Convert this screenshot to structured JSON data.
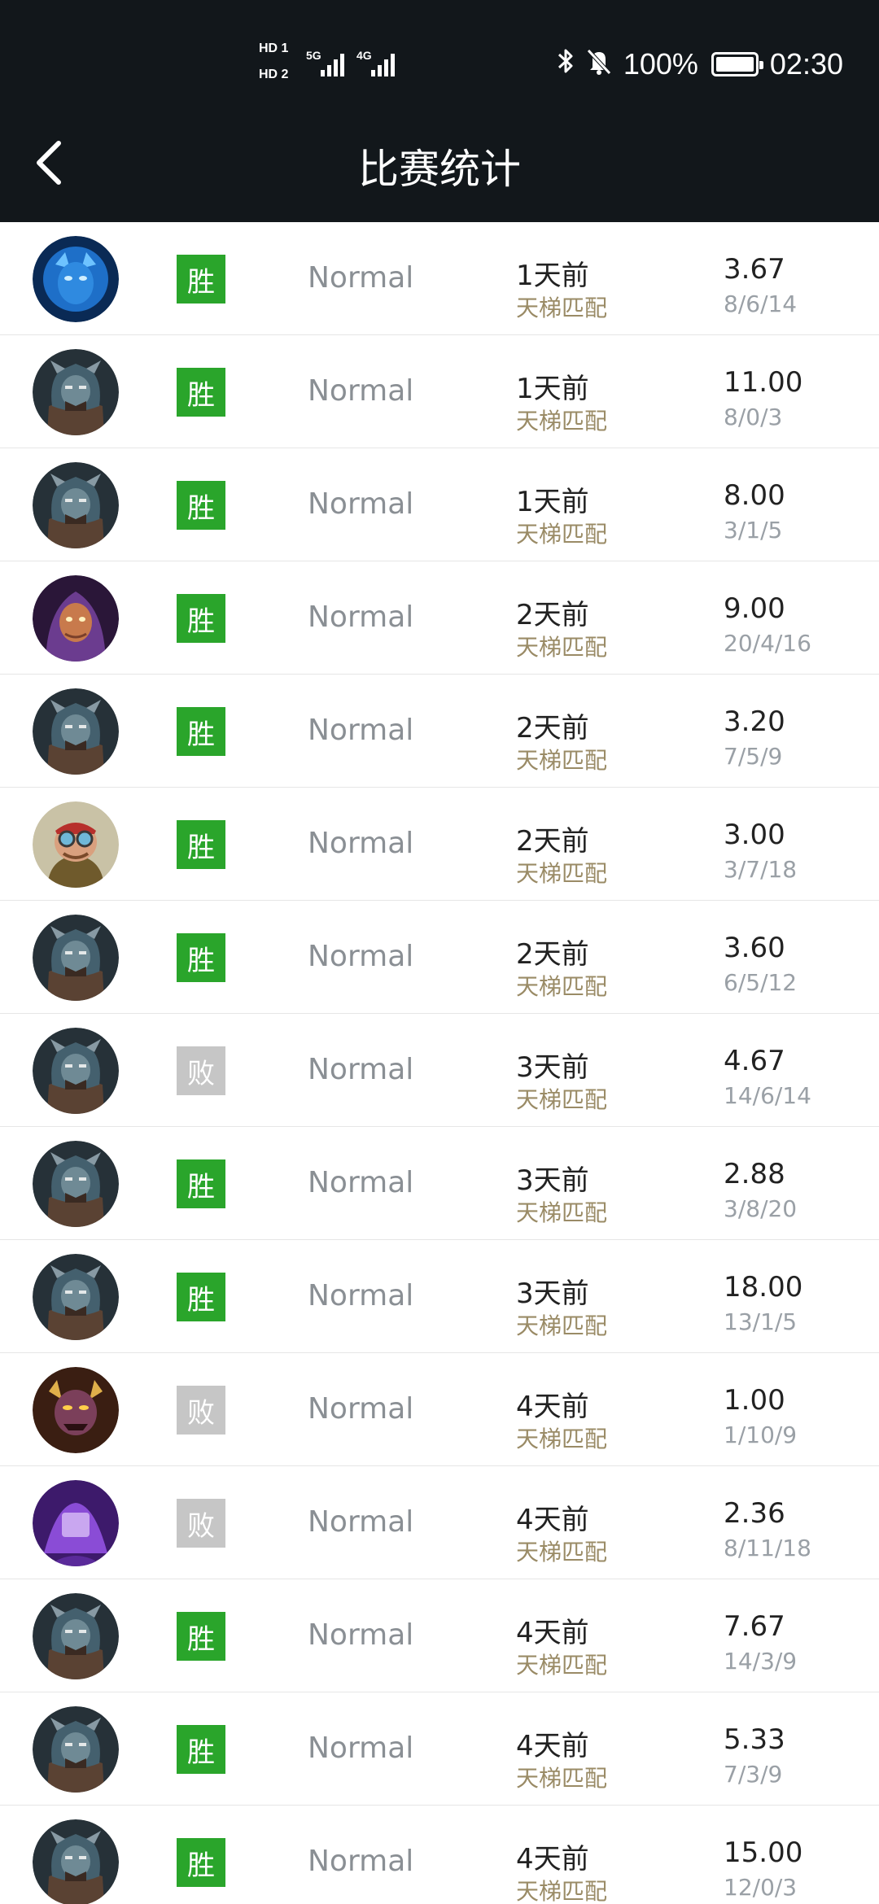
{
  "status_bar": {
    "sim1": "HD 1",
    "sim2": "HD 2",
    "net1": "5G",
    "net2": "4G",
    "battery": "100%",
    "time": "02:30",
    "icons": [
      "bluetooth-icon",
      "mute-icon",
      "battery-icon"
    ]
  },
  "header": {
    "title": "比赛统计",
    "back_icon": "chevron-left-icon"
  },
  "colors": {
    "header_bg": "#12171b",
    "win": "#2aa52b",
    "loss": "#c6c6c6",
    "match_type": "#9a8b66"
  },
  "matches": [
    {
      "hero": "blue-hero",
      "result": "胜",
      "win": true,
      "mode": "Normal",
      "time": "1天前",
      "type": "天梯匹配",
      "kda": "3.67",
      "detail": "8/6/14"
    },
    {
      "hero": "armored-hero",
      "result": "胜",
      "win": true,
      "mode": "Normal",
      "time": "1天前",
      "type": "天梯匹配",
      "kda": "11.00",
      "detail": "8/0/3"
    },
    {
      "hero": "armored-hero",
      "result": "胜",
      "win": true,
      "mode": "Normal",
      "time": "1天前",
      "type": "天梯匹配",
      "kda": "8.00",
      "detail": "3/1/5"
    },
    {
      "hero": "purple-hooded-hero",
      "result": "胜",
      "win": true,
      "mode": "Normal",
      "time": "2天前",
      "type": "天梯匹配",
      "kda": "9.00",
      "detail": "20/4/16"
    },
    {
      "hero": "armored-hero",
      "result": "胜",
      "win": true,
      "mode": "Normal",
      "time": "2天前",
      "type": "天梯匹配",
      "kda": "3.20",
      "detail": "7/5/9"
    },
    {
      "hero": "goggles-hero",
      "result": "胜",
      "win": true,
      "mode": "Normal",
      "time": "2天前",
      "type": "天梯匹配",
      "kda": "3.00",
      "detail": "3/7/18"
    },
    {
      "hero": "armored-hero",
      "result": "胜",
      "win": true,
      "mode": "Normal",
      "time": "2天前",
      "type": "天梯匹配",
      "kda": "3.60",
      "detail": "6/5/12"
    },
    {
      "hero": "armored-hero",
      "result": "败",
      "win": false,
      "mode": "Normal",
      "time": "3天前",
      "type": "天梯匹配",
      "kda": "4.67",
      "detail": "14/6/14"
    },
    {
      "hero": "armored-hero",
      "result": "胜",
      "win": true,
      "mode": "Normal",
      "time": "3天前",
      "type": "天梯匹配",
      "kda": "2.88",
      "detail": "3/8/20"
    },
    {
      "hero": "armored-hero",
      "result": "胜",
      "win": true,
      "mode": "Normal",
      "time": "3天前",
      "type": "天梯匹配",
      "kda": "18.00",
      "detail": "13/1/5"
    },
    {
      "hero": "demon-hero",
      "result": "败",
      "win": false,
      "mode": "Normal",
      "time": "4天前",
      "type": "天梯匹配",
      "kda": "1.00",
      "detail": "1/10/9"
    },
    {
      "hero": "violet-hero",
      "result": "败",
      "win": false,
      "mode": "Normal",
      "time": "4天前",
      "type": "天梯匹配",
      "kda": "2.36",
      "detail": "8/11/18"
    },
    {
      "hero": "armored-hero",
      "result": "胜",
      "win": true,
      "mode": "Normal",
      "time": "4天前",
      "type": "天梯匹配",
      "kda": "7.67",
      "detail": "14/3/9"
    },
    {
      "hero": "armored-hero",
      "result": "胜",
      "win": true,
      "mode": "Normal",
      "time": "4天前",
      "type": "天梯匹配",
      "kda": "5.33",
      "detail": "7/3/9"
    },
    {
      "hero": "armored-hero",
      "result": "胜",
      "win": true,
      "mode": "Normal",
      "time": "4天前",
      "type": "天梯匹配",
      "kda": "15.00",
      "detail": "12/0/3"
    }
  ]
}
